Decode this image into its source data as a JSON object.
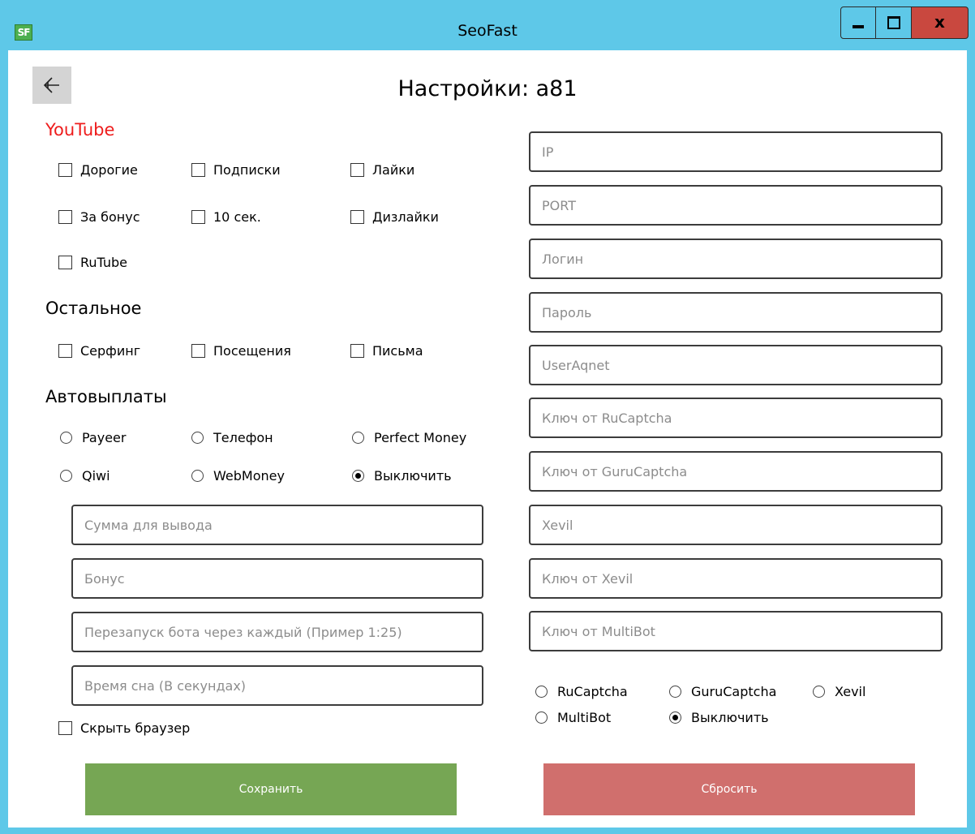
{
  "window": {
    "title": "SeoFast",
    "icon_text": "SF",
    "close_glyph": "x"
  },
  "page": {
    "title": "Настройки: a81"
  },
  "youtube": {
    "title": "YouTube",
    "items": [
      {
        "label": "Дорогие",
        "checked": false
      },
      {
        "label": "Подписки",
        "checked": false
      },
      {
        "label": "Лайки",
        "checked": false
      },
      {
        "label": "За бонус",
        "checked": false
      },
      {
        "label": "10 сек.",
        "checked": false
      },
      {
        "label": "Дизлайки",
        "checked": false
      },
      {
        "label": "RuTube",
        "checked": false
      }
    ]
  },
  "other": {
    "title": "Остальное",
    "items": [
      {
        "label": "Серфинг",
        "checked": false
      },
      {
        "label": "Посещения",
        "checked": false
      },
      {
        "label": "Письма",
        "checked": false
      }
    ]
  },
  "payouts": {
    "title": "Автовыплаты",
    "options": [
      {
        "label": "Payeer",
        "selected": false
      },
      {
        "label": "Телефон",
        "selected": false
      },
      {
        "label": "Perfect Money",
        "selected": false
      },
      {
        "label": "Qiwi",
        "selected": false
      },
      {
        "label": "WebMoney",
        "selected": false
      },
      {
        "label": "Выключить",
        "selected": true
      }
    ],
    "fields": [
      {
        "placeholder": "Сумма для вывода",
        "value": ""
      },
      {
        "placeholder": "Бонус",
        "value": ""
      },
      {
        "placeholder": "Перезапуск бота через каждый (Пример 1:25)",
        "value": ""
      },
      {
        "placeholder": "Время сна (В секундах)",
        "value": ""
      }
    ]
  },
  "hide_browser": {
    "label": "Скрыть браузер",
    "checked": false
  },
  "right_fields": [
    {
      "placeholder": "IP",
      "value": ""
    },
    {
      "placeholder": "PORT",
      "value": ""
    },
    {
      "placeholder": "Логин",
      "value": ""
    },
    {
      "placeholder": "Пароль",
      "value": ""
    },
    {
      "placeholder": "UserAqnet",
      "value": ""
    },
    {
      "placeholder": "Ключ от RuCaptcha",
      "value": ""
    },
    {
      "placeholder": "Ключ от GuruCaptcha",
      "value": ""
    },
    {
      "placeholder": "Xevil",
      "value": ""
    },
    {
      "placeholder": "Ключ от Xevil",
      "value": ""
    },
    {
      "placeholder": "Ключ от MultiBot",
      "value": ""
    }
  ],
  "captcha": {
    "options": [
      {
        "label": "RuCaptcha",
        "selected": false
      },
      {
        "label": "GuruCaptcha",
        "selected": false
      },
      {
        "label": "Xevil",
        "selected": false
      },
      {
        "label": "MultiBot",
        "selected": false
      },
      {
        "label": "Выключить",
        "selected": true
      }
    ]
  },
  "buttons": {
    "save": "Сохранить",
    "reset": "Сбросить"
  },
  "colors": {
    "titlebar": "#5ec8e8",
    "close_button": "#c9483f",
    "accent_red": "#ee1c1c",
    "save_button": "#76a654",
    "reset_button": "#d06f6d",
    "placeholder_text": "#8c8c8c"
  },
  "icons": {
    "back": "arrow-left-icon",
    "minimize": "minimize-icon",
    "maximize": "maximize-icon",
    "close": "close-icon"
  }
}
